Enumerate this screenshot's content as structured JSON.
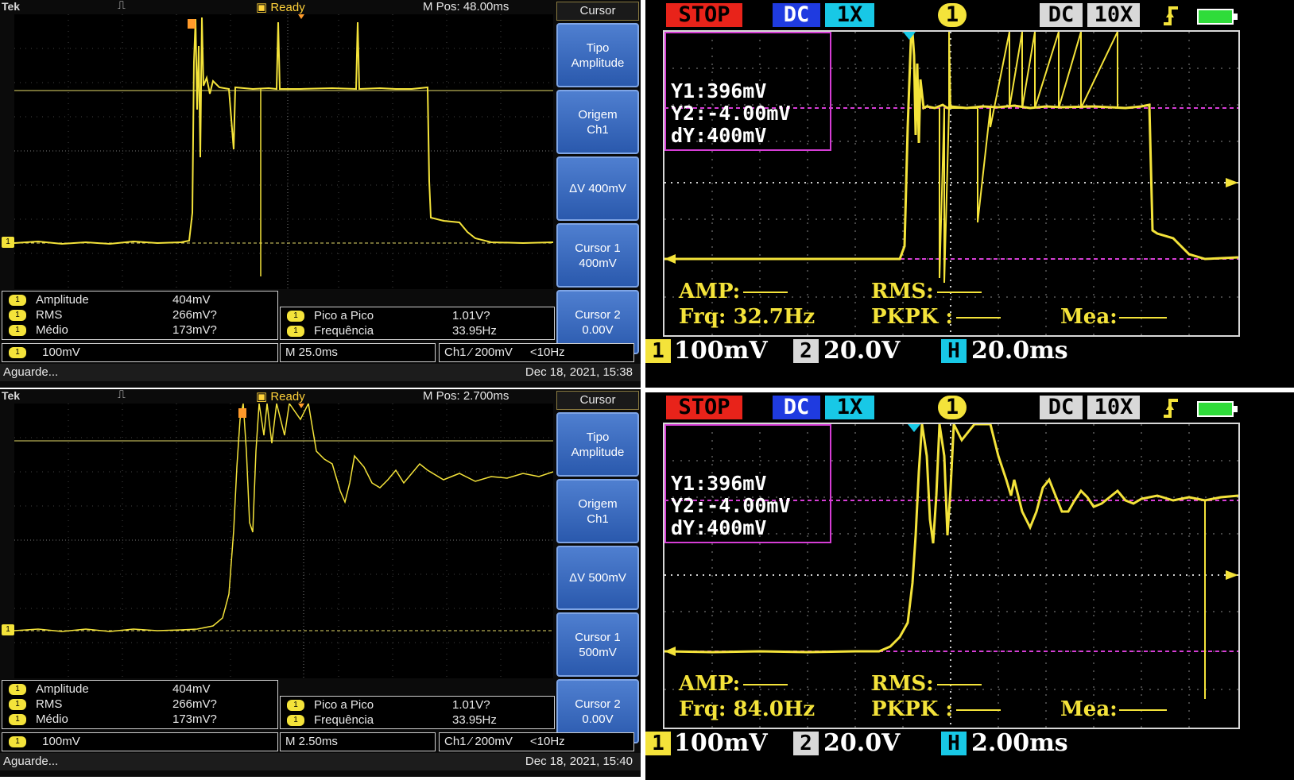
{
  "tek_panels": [
    {
      "brand": "Tek",
      "trigger_icon": "⎍",
      "status": "Ready",
      "mpos": "M Pos: 48.00ms",
      "ch_marker": "1",
      "side_menu": {
        "title": "Cursor",
        "buttons": [
          {
            "line1": "Tipo",
            "line2": "Amplitude"
          },
          {
            "line1": "Origem",
            "line2": "Ch1"
          },
          {
            "line1": "ΔV 400mV",
            "line2": ""
          },
          {
            "line1": "Cursor 1",
            "line2": "400mV"
          },
          {
            "line1": "Cursor 2",
            "line2": "0.00V"
          }
        ]
      },
      "measurements_left": [
        {
          "ch": "1",
          "name": "Amplitude",
          "value": "404mV"
        },
        {
          "ch": "1",
          "name": "RMS",
          "value": "266mV?"
        },
        {
          "ch": "1",
          "name": "Médio",
          "value": "173mV?"
        }
      ],
      "measurements_right": [
        {
          "ch": "1",
          "name": "Pico a Pico",
          "value": "1.01V?"
        },
        {
          "ch": "1",
          "name": "Frequência",
          "value": "33.95Hz"
        }
      ],
      "scale": {
        "ch": "1",
        "value": "100mV"
      },
      "timebase": "M 25.0ms",
      "trigger": "Ch1 ⁄ 200mV",
      "trigger_freq": "<10Hz",
      "footer_left": "Aguarde...",
      "footer_right": "Dec 18, 2021, 15:38"
    },
    {
      "brand": "Tek",
      "trigger_icon": "⎍",
      "status": "Ready",
      "mpos": "M Pos: 2.700ms",
      "ch_marker": "1",
      "side_menu": {
        "title": "Cursor",
        "buttons": [
          {
            "line1": "Tipo",
            "line2": "Amplitude"
          },
          {
            "line1": "Origem",
            "line2": "Ch1"
          },
          {
            "line1": "ΔV 500mV",
            "line2": ""
          },
          {
            "line1": "Cursor 1",
            "line2": "500mV"
          },
          {
            "line1": "Cursor 2",
            "line2": "0.00V"
          }
        ]
      },
      "measurements_left": [
        {
          "ch": "1",
          "name": "Amplitude",
          "value": "404mV"
        },
        {
          "ch": "1",
          "name": "RMS",
          "value": "266mV?"
        },
        {
          "ch": "1",
          "name": "Médio",
          "value": "173mV?"
        }
      ],
      "measurements_right": [
        {
          "ch": "1",
          "name": "Pico a Pico",
          "value": "1.01V?"
        },
        {
          "ch": "1",
          "name": "Frequência",
          "value": "33.95Hz"
        }
      ],
      "scale": {
        "ch": "1",
        "value": "100mV"
      },
      "timebase": "M 2.50ms",
      "trigger": "Ch1 ⁄ 200mV",
      "trigger_freq": "<10Hz",
      "footer_left": "Aguarde...",
      "footer_right": "Dec 18, 2021, 15:40"
    }
  ],
  "dso_panels": [
    {
      "run_state": "STOP",
      "coupling": "DC",
      "probe": "1X",
      "channel": "1",
      "ch2_coupling": "DC",
      "ch2_probe": "10X",
      "trigger_edge_icon": "rising-edge-icon",
      "battery_icon": "battery-icon",
      "cursor": {
        "y1": "Y1:396mV",
        "y2": "Y2:-4.00mV",
        "dy": "dY:400mV"
      },
      "meas": {
        "amp_label": "AMP:",
        "rms_label": "RMS:",
        "frq": "Frq: 32.7Hz",
        "pkpk_label": "PKPK :",
        "mea_label": "Mea:"
      },
      "ch1_scale": "100mV",
      "ch2_scale": "20.0V",
      "timebase": "20.0ms",
      "chips": {
        "ch1": "1",
        "ch2": "2",
        "h": "H"
      }
    },
    {
      "run_state": "STOP",
      "coupling": "DC",
      "probe": "1X",
      "channel": "1",
      "ch2_coupling": "DC",
      "ch2_probe": "10X",
      "trigger_edge_icon": "rising-edge-icon",
      "battery_icon": "battery-icon",
      "cursor": {
        "y1": "Y1:396mV",
        "y2": "Y2:-4.00mV",
        "dy": "dY:400mV"
      },
      "meas": {
        "amp_label": "AMP:",
        "rms_label": "RMS:",
        "frq": "Frq: 84.0Hz",
        "pkpk_label": "PKPK :",
        "mea_label": "Mea:"
      },
      "ch1_scale": "100mV",
      "ch2_scale": "20.0V",
      "timebase": "2.00ms",
      "chips": {
        "ch1": "1",
        "ch2": "2",
        "h": "H"
      }
    }
  ],
  "colors": {
    "trace": "#f4e33a",
    "cursor_line": "#d63dd6",
    "stop": "#e8231a",
    "dc_tag": "#1f3be0",
    "probe_tag": "#18c8e6",
    "gray_tag": "#d8d8d8",
    "side_button": "#3a6cc4"
  }
}
